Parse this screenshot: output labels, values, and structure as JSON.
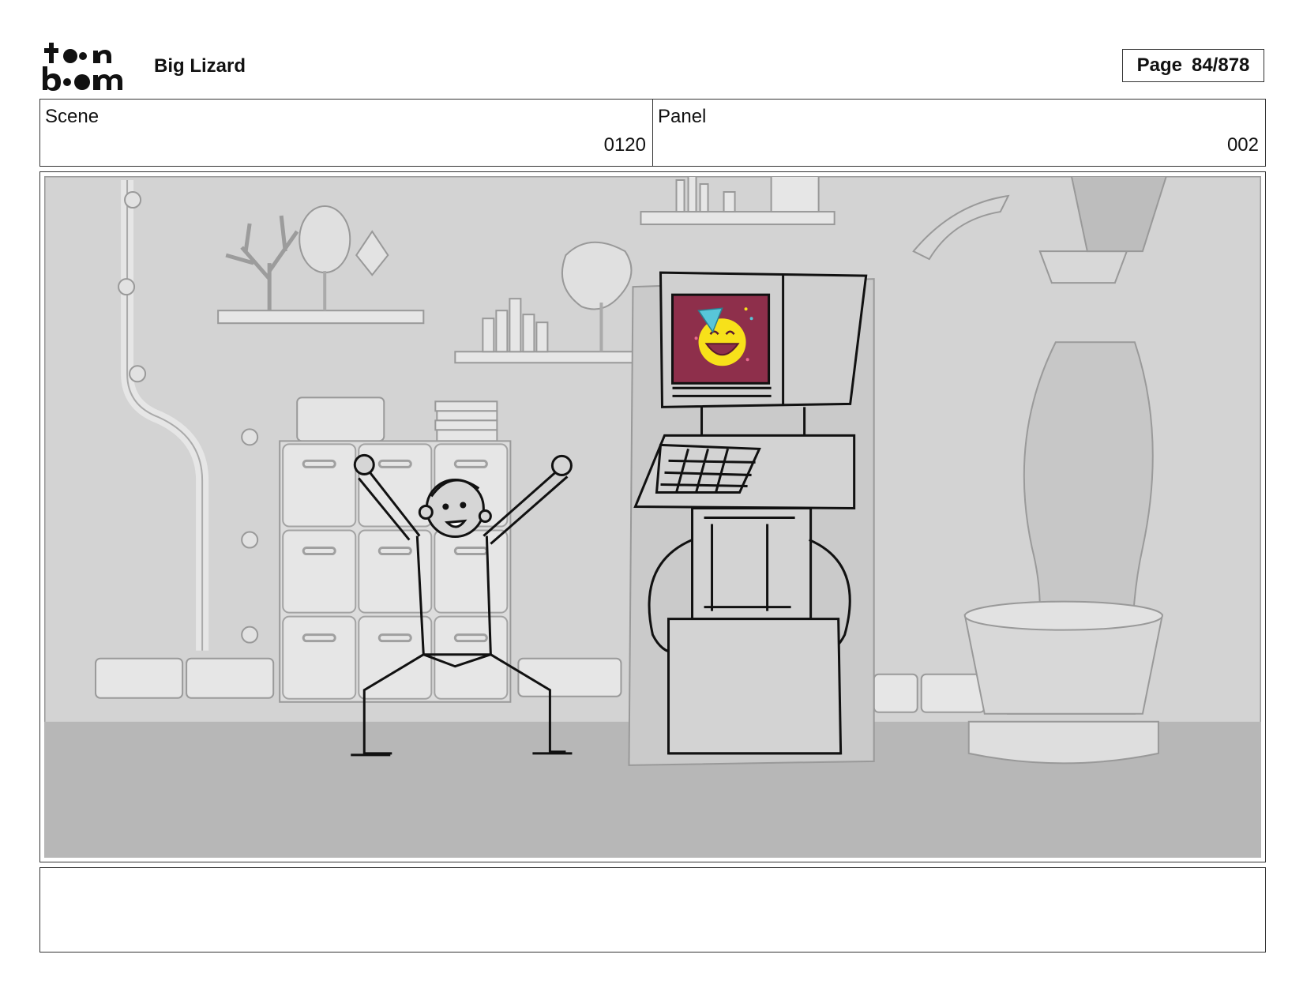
{
  "header": {
    "logo_alt": "toon boom",
    "project_title": "Big Lizard",
    "page_label": "Page",
    "page_number": "84/878"
  },
  "scene": {
    "label": "Scene",
    "value": "0120"
  },
  "panel": {
    "label": "Panel",
    "value": "002"
  },
  "notes": {
    "text": ""
  },
  "colors": {
    "screen": "#8e2f4b",
    "emoji": "#f7e11a",
    "party_hat": "#58c6d9",
    "background": "#d3d3d3",
    "floor": "#b7b7b7"
  }
}
